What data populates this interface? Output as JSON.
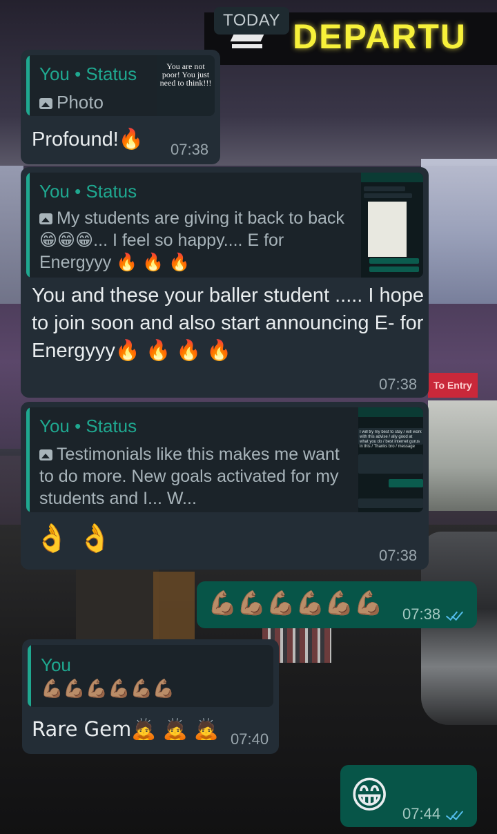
{
  "date_chip": "TODAY",
  "wallpaper_sign_text": "DEPARTU",
  "wallpaper_shop_sign": "To Entry",
  "colors": {
    "incoming_bubble": "#232d36",
    "outgoing_bubble": "#075548",
    "quote_accent": "#1fa890",
    "read_ticks": "#53bdeb"
  },
  "messages": [
    {
      "direction": "incoming",
      "reply": {
        "author": "You • Status",
        "media_icon": "image-icon",
        "text": "Photo",
        "thumbnail_text": "You are not poor! You just need to think!!!"
      },
      "text": "Profound!🔥",
      "time": "07:38"
    },
    {
      "direction": "incoming",
      "reply": {
        "author": "You • Status",
        "media_icon": "image-icon",
        "text": "My students are giving it back to back 😁😁😁... I feel so happy.... E for Energyyy 🔥 🔥 🔥"
      },
      "text": "You and these your baller student ..... I hope to join soon and also start announcing E- for Energyyy🔥 🔥 🔥 🔥",
      "time": "07:38"
    },
    {
      "direction": "incoming",
      "reply": {
        "author": "You • Status",
        "media_icon": "image-icon",
        "text": "Testimonials like this makes me want to do more. New goals activated for my students and I... W...",
        "thumbnail_text": "I will try my best to stay / will work with this advise / ally good at what you do / best internet gurus in this / Thanks bro / message"
      },
      "text": "👌 👌",
      "time": "07:38"
    },
    {
      "direction": "outgoing",
      "text": "💪🏽💪🏽💪🏽💪🏽💪🏽💪🏽",
      "time": "07:38",
      "status": "read"
    },
    {
      "direction": "incoming",
      "reply": {
        "author": "You",
        "text": "💪🏽💪🏽💪🏽💪🏽💪🏽💪🏽"
      },
      "text": "Rare Gem🙇 🙇 🙇",
      "time": "07:40"
    },
    {
      "direction": "outgoing",
      "text": "😁",
      "time": "07:44",
      "status": "read"
    }
  ]
}
